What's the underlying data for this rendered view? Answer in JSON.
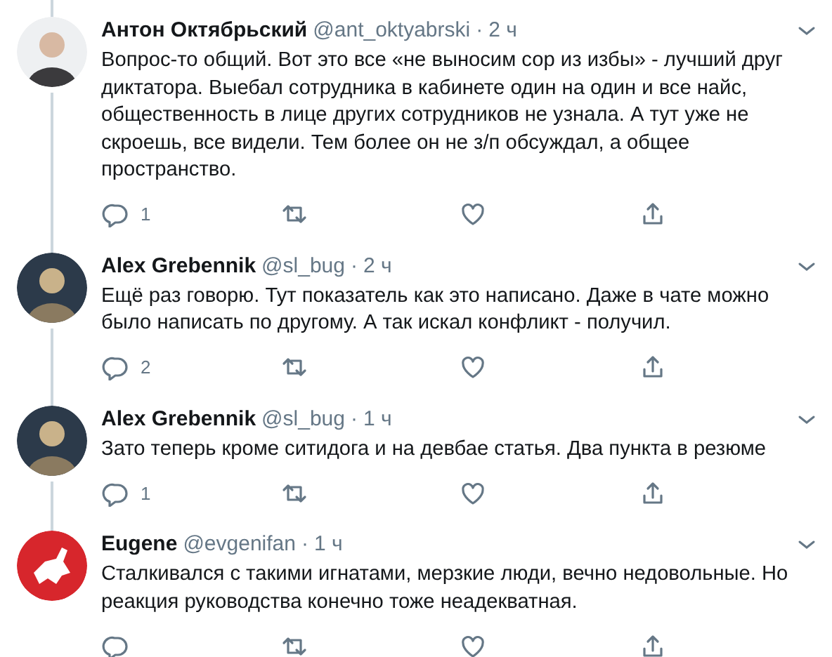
{
  "tweets": [
    {
      "avatar": {
        "kind": "person"
      },
      "name": "Антон Октябрьский",
      "handle": "@ant_oktyabrski",
      "separator": "·",
      "time": "2 ч",
      "text": "Вопрос-то общий. Вот это все «не выносим сор из избы» - лучший друг диктатора. Выебал сотрудника в кабинете один на один и все найс, общественность в лице других сотрудников не узнала. А тут уже не скроешь, все видели. Тем более он не з/п обсуждал, а общее пространство.",
      "replies": "1",
      "line_above": true,
      "line_below": true
    },
    {
      "avatar": {
        "kind": "person"
      },
      "name": "Alex Grebennik",
      "handle": "@sl_bug",
      "separator": "·",
      "time": "2 ч",
      "text": "Ещё раз говорю. Тут показатель как это написано. Даже в чате можно было написать по другому. А так искал конфликт - получил.",
      "replies": "2",
      "line_above": true,
      "line_below": true
    },
    {
      "avatar": {
        "kind": "person"
      },
      "name": "Alex Grebennik",
      "handle": "@sl_bug",
      "separator": "·",
      "time": "1 ч",
      "text": "Зато теперь кроме ситидога и на девбае статья. Два пункта в резюме",
      "replies": "1",
      "line_above": true,
      "line_below": true
    },
    {
      "avatar": {
        "kind": "emblem"
      },
      "name": "Eugene",
      "handle": "@evgenifan",
      "separator": "·",
      "time": "1 ч",
      "text": "Сталкивался с такими игнатами, мерзкие люди, вечно недовольные. Но реакция руководства конечно тоже неадекватная.",
      "line_above": true,
      "line_below": false
    }
  ]
}
